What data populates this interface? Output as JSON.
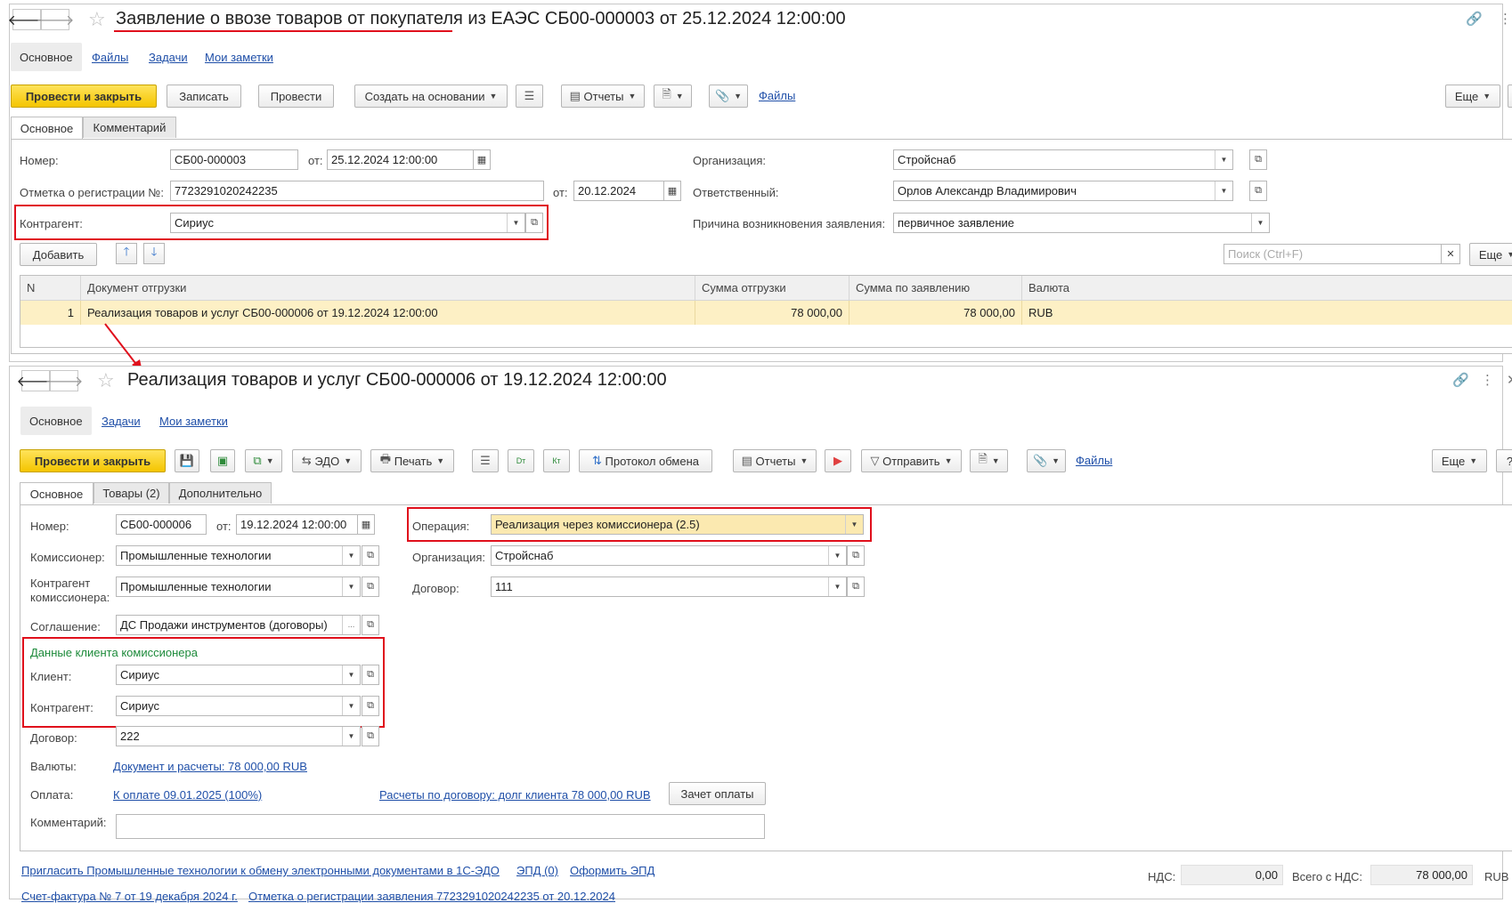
{
  "doc1": {
    "title": "Заявление о ввозе товаров от покупателя из ЕАЭС СБ00-000003 от 25.12.2024 12:00:00",
    "sections": [
      "Основное",
      "Файлы",
      "Задачи",
      "Мои заметки"
    ],
    "toolbar": {
      "post_close": "Провести и закрыть",
      "save": "Записать",
      "post": "Провести",
      "create_based": "Создать на основании",
      "reports": "Отчеты",
      "files": "Файлы",
      "more": "Еще",
      "help": "?"
    },
    "tabs": [
      "Основное",
      "Комментарий"
    ],
    "fields": {
      "number_label": "Номер:",
      "number": "СБ00-000003",
      "from_label": "от:",
      "date": "25.12.2024 12:00:00",
      "reg_label": "Отметка о регистрации №:",
      "reg_number": "7723291020242235",
      "reg_from_label": "от:",
      "reg_date": "20.12.2024",
      "counterparty_label": "Контрагент:",
      "counterparty": "Сириус",
      "org_label": "Организация:",
      "org": "Стройснаб",
      "responsible_label": "Ответственный:",
      "responsible": "Орлов Александр Владимирович",
      "reason_label": "Причина возникновения заявления:",
      "reason": "первичное заявление"
    },
    "table_toolbar": {
      "add": "Добавить",
      "search_placeholder": "Поиск (Ctrl+F)",
      "more": "Еще"
    },
    "table": {
      "columns": [
        "N",
        "Документ отгрузки",
        "Сумма отгрузки",
        "Сумма по заявлению",
        "Валюта"
      ],
      "rows": [
        [
          "1",
          "Реализация товаров и услуг СБ00-000006 от 19.12.2024 12:00:00",
          "78 000,00",
          "78 000,00",
          "RUB"
        ]
      ]
    }
  },
  "doc2": {
    "title": "Реализация товаров и услуг СБ00-000006 от 19.12.2024 12:00:00",
    "sections": [
      "Основное",
      "Задачи",
      "Мои заметки"
    ],
    "toolbar": {
      "post_close": "Провести и закрыть",
      "edo": "ЭДО",
      "print": "Печать",
      "dt": "Dт",
      "kt": "Кт",
      "protocol": "Протокол обмена",
      "reports": "Отчеты",
      "send": "Отправить",
      "files": "Файлы",
      "more": "Еще",
      "help": "?"
    },
    "tabs": [
      "Основное",
      "Товары (2)",
      "Дополнительно"
    ],
    "fields": {
      "number_label": "Номер:",
      "number": "СБ00-000006",
      "from_label": "от:",
      "date": "19.12.2024 12:00:00",
      "operation_label": "Операция:",
      "operation": "Реализация через комиссионера (2.5)",
      "commissioner_label": "Комиссионер:",
      "commissioner": "Промышленные технологии",
      "org_label": "Организация:",
      "org": "Стройснаб",
      "comm_cp_label_1": "Контрагент",
      "comm_cp_label_2": "комиссионера:",
      "comm_cp": "Промышленные технологии",
      "contract_label": "Договор:",
      "contract": "111",
      "agreement_label": "Соглашение:",
      "agreement": "ДС Продажи инструментов (договоры)",
      "client_section": "Данные клиента комиссионера",
      "client_label": "Клиент:",
      "client": "Сириус",
      "counterparty_label": "Контрагент:",
      "counterparty": "Сириус",
      "contract2_label": "Договор:",
      "contract2": "222",
      "currency_label": "Валюты:",
      "currency_link": "Документ и расчеты: 78 000,00 RUB",
      "payment_label": "Оплата:",
      "payment_link": "К оплате 09.01.2025 (100%)",
      "settlements_link": "Расчеты по договору: долг клиента 78 000,00 RUB",
      "offset_button": "Зачет оплаты",
      "comment_label": "Комментарий:",
      "comment": ""
    },
    "footer": {
      "invite_link": "Пригласить Промышленные технологии к обмену электронными документами в 1С-ЭДО",
      "epd_link": "ЭПД (0)",
      "issue_epd_link": "Оформить ЭПД",
      "invoice_link": "Счет-фактура № 7 от 19 декабря 2024 г.",
      "registration_link": "Отметка о регистрации заявления 7723291020242235 от 20.12.2024",
      "vat_label": "НДС:",
      "vat": "0,00",
      "total_label": "Всего с НДС:",
      "total": "78 000,00",
      "currency": "RUB"
    }
  },
  "colors": {
    "primary_button": "#f4c500",
    "highlight_red": "#e0101c",
    "link": "#1f4fa8",
    "selected_row": "#fdf0c5",
    "section_green": "#1c8a3a"
  },
  "icons": [
    "back-arrow-icon",
    "forward-arrow-icon",
    "star-icon",
    "link-icon",
    "more-vertical-icon",
    "close-icon",
    "calendar-icon",
    "open-icon",
    "dropdown-icon",
    "save-icon",
    "paperclip-icon"
  ]
}
